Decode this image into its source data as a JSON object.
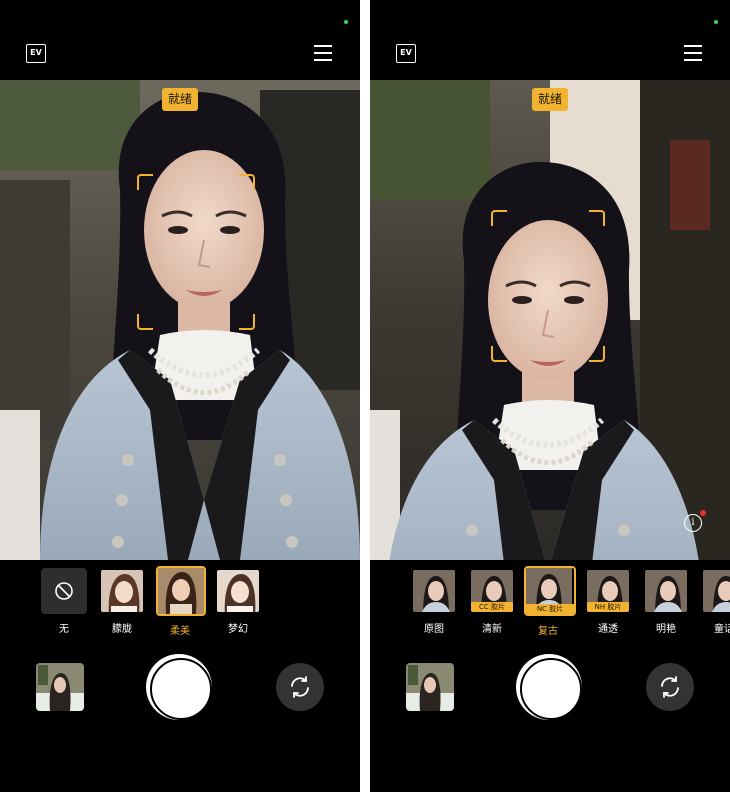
{
  "colors": {
    "accent": "#f2b430",
    "indicator": "#3ccf5a",
    "background": "#000000"
  },
  "left_screen": {
    "top_bar": {
      "ev_label": "EV",
      "menu_icon": "menu-icon"
    },
    "status_badge": "就绪",
    "filters": [
      {
        "label": "无",
        "icon": "no-filter-icon",
        "selected": false
      },
      {
        "label": "朦胧",
        "selected": false
      },
      {
        "label": "柔美",
        "selected": true
      },
      {
        "label": "梦幻",
        "selected": false
      }
    ],
    "bottom": {
      "gallery_icon": "gallery-thumbnail",
      "shutter_icon": "shutter-button",
      "switch_icon": "switch-camera-icon"
    }
  },
  "right_screen": {
    "top_bar": {
      "ev_label": "EV",
      "menu_icon": "menu-icon"
    },
    "status_badge": "就绪",
    "filters": [
      {
        "label": "原图",
        "tag": "",
        "selected": false
      },
      {
        "label": "清新",
        "tag": "CC 胶片",
        "selected": false
      },
      {
        "label": "复古",
        "tag": "NC 胶片",
        "selected": true
      },
      {
        "label": "通透",
        "tag": "NH 胶片",
        "selected": false
      },
      {
        "label": "明艳",
        "tag": "",
        "selected": false
      },
      {
        "label": "童话",
        "tag": "",
        "selected": false
      }
    ],
    "info_label": "i",
    "bottom": {
      "gallery_icon": "gallery-thumbnail",
      "shutter_icon": "shutter-button",
      "switch_icon": "switch-camera-icon"
    }
  }
}
